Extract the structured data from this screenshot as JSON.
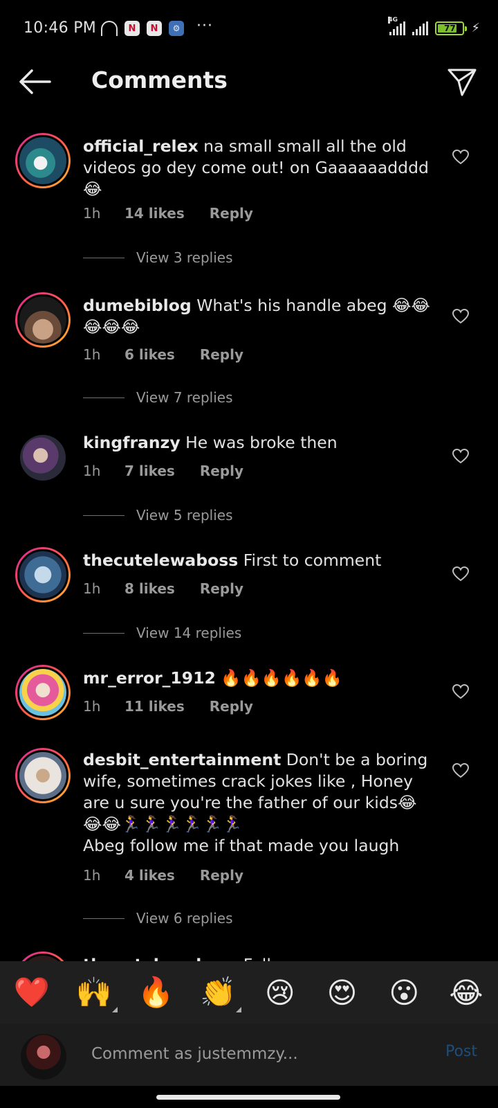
{
  "status": {
    "time": "10:46 PM",
    "network": "4G",
    "battery": "77",
    "battery_level": 0.77
  },
  "header": {
    "title": "Comments"
  },
  "comments": [
    {
      "username": "official_relex",
      "text": "na small small all the old videos go dey come out! on Gaaaaaadddd 😂",
      "time": "1h",
      "likes": "14 likes",
      "reply": "Reply",
      "view_replies": "View 3 replies"
    },
    {
      "username": "dumebiblog",
      "text": "What's his handle abeg 😂😂😂😂😂",
      "time": "1h",
      "likes": "6 likes",
      "reply": "Reply",
      "view_replies": "View 7 replies"
    },
    {
      "username": "kingfranzy",
      "text": "He was broke then",
      "time": "1h",
      "likes": "7 likes",
      "reply": "Reply",
      "view_replies": "View 5 replies"
    },
    {
      "username": "thecutelewaboss",
      "text": "First to comment",
      "time": "1h",
      "likes": "8 likes",
      "reply": "Reply",
      "view_replies": "View 14 replies"
    },
    {
      "username": "mr_error_1912",
      "text": "🔥🔥🔥🔥🔥🔥",
      "time": "1h",
      "likes": "11 likes",
      "reply": "Reply"
    },
    {
      "username": "desbit_entertainment",
      "text": "Don't be a boring wife, sometimes crack jokes like , Honey are u sure you're the father of our kids😂😂😂🏃‍♀️🏃‍♀️🏃‍♀️🏃‍♀️🏃‍♀️🏃‍♀️",
      "text2": "Abeg follow me if that made you laugh",
      "time": "1h",
      "likes": "4 likes",
      "reply": "Reply",
      "view_replies": "View 6 replies"
    },
    {
      "username": "thecutelewaboss",
      "text": "Follow me"
    }
  ],
  "reactions": [
    "❤️",
    "🙌",
    "🔥",
    "👏",
    "😢",
    "😍",
    "😮",
    "😂"
  ],
  "input": {
    "placeholder": "Comment as justemmzy...",
    "post_label": "Post"
  }
}
